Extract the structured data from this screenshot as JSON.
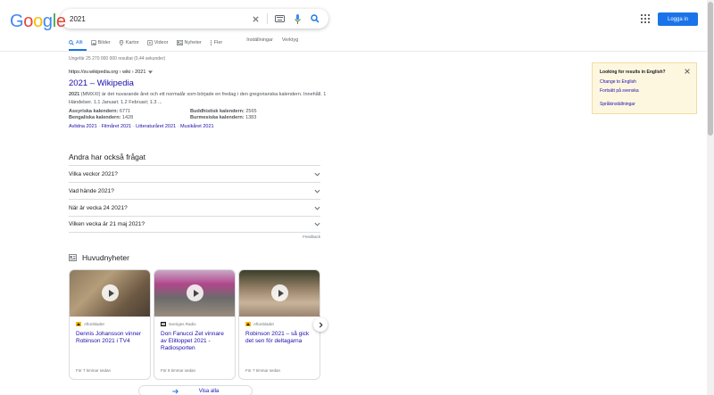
{
  "logo": {
    "letters": [
      "G",
      "o",
      "o",
      "g",
      "l",
      "e"
    ],
    "colors": [
      "#4285f4",
      "#ea4335",
      "#fbbc05",
      "#4285f4",
      "#34a853",
      "#ea4335"
    ]
  },
  "search": {
    "value": "2021"
  },
  "header": {
    "login_label": "Logga in"
  },
  "tabs": [
    {
      "label": "Allt",
      "icon": "search-icon"
    },
    {
      "label": "Bilder",
      "icon": "image-icon"
    },
    {
      "label": "Kartor",
      "icon": "map-pin-icon"
    },
    {
      "label": "Videor",
      "icon": "video-icon"
    },
    {
      "label": "Nyheter",
      "icon": "news-icon"
    },
    {
      "label": "Fler",
      "icon": "more-icon"
    }
  ],
  "tools": {
    "settings": "Inställningar",
    "tools": "Verktyg"
  },
  "stats": "Ungefär 25 270 000 000 resultat (0,44 sekunder)",
  "result": {
    "url": "https://sv.wikipedia.org › wiki › 2021",
    "title": "2021 – Wikipedia",
    "snippet_bold": "2021",
    "snippet_rest": " (MMXXI) är det nuvarande året och ett normalår som började en fredag i den gregorianska kalendern. Innehåll. 1 Händelser. 1.1 Januari; 1.2 Februari; 1.3 ...",
    "facts": [
      {
        "label": "Assyriska kalendern:",
        "value": "6771"
      },
      {
        "label": "Buddhistisk kalendern:",
        "value": "2565"
      },
      {
        "label": "Bengaliska kalendern:",
        "value": "1428"
      },
      {
        "label": "Burmesiska kalendern:",
        "value": "1383"
      }
    ],
    "sitelinks": [
      "Avlidna 2021",
      "Filmåret 2021",
      "Litteraturåret 2021",
      "Musikåret 2021"
    ],
    "sitelink_sep": " · "
  },
  "paa": {
    "title": "Andra har också frågat",
    "questions": [
      "Vilka veckor 2021?",
      "Vad hände 2021?",
      "När är vecka 24 2021?",
      "Vilken vecka är 21 maj 2021?"
    ],
    "feedback": "Feedback"
  },
  "news": {
    "title": "Huvudnyheter",
    "cards": [
      {
        "source": "Aftonbladet",
        "title": "Dennis Johansson vinner Robinson 2021 i TV4",
        "time": "För 7 timmar sedan"
      },
      {
        "source": "Sveriges Radio",
        "title": "Don Fanucci Zet vinnare av Elitloppet 2021 - Radiosporten",
        "time": "För 8 timmar sedan"
      },
      {
        "source": "Aftonbladet",
        "title": "Robinson 2021 – så gick det sen för deltagarna",
        "time": "För 7 timmar sedan"
      }
    ],
    "view_all": "Visa alla"
  },
  "lang_panel": {
    "question": "Looking for results in English?",
    "change": "Change to English",
    "continue": "Fortsätt på svenska",
    "settings": "Språkinställningar"
  }
}
